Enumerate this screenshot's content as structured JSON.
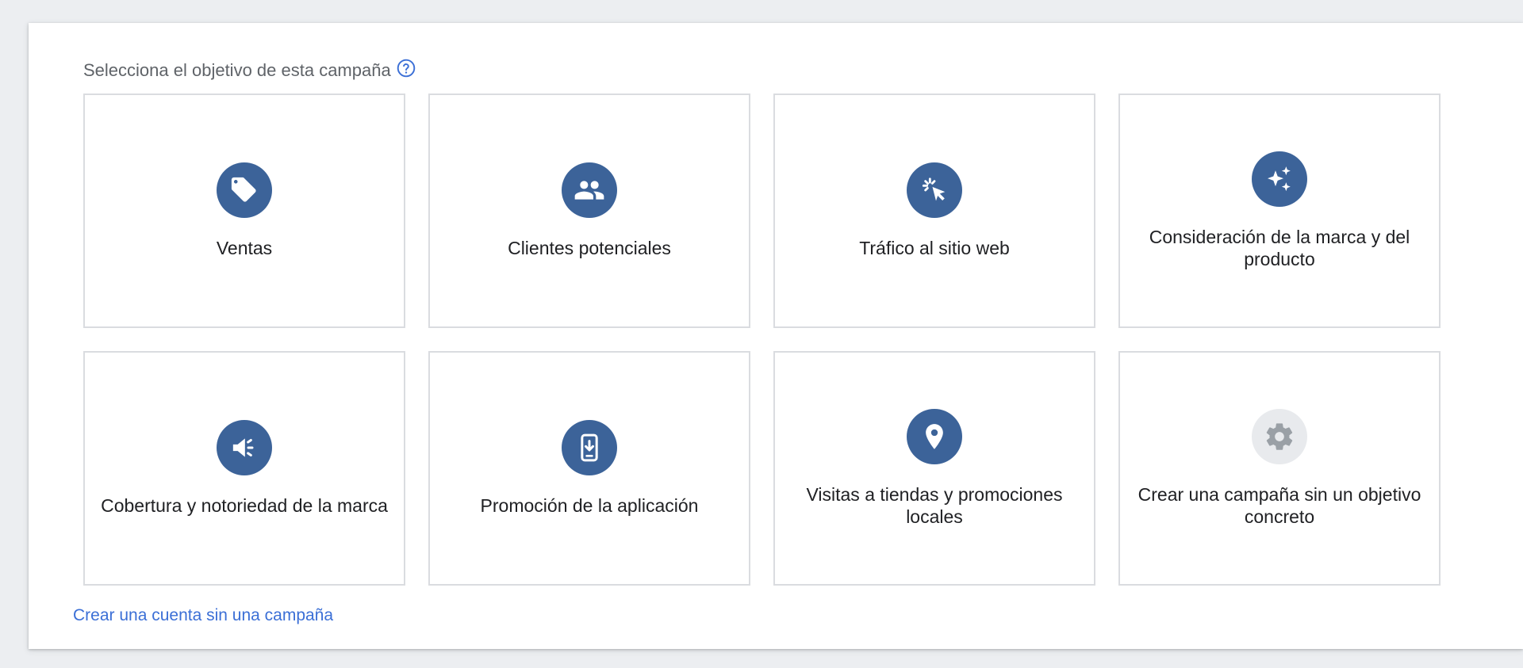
{
  "heading": {
    "text": "Selecciona el objetivo de esta campaña",
    "help_icon": "help-circle-outline-icon"
  },
  "colors": {
    "accent": "#3c6399",
    "link": "#3b6fd6",
    "disabled_circle": "#e8eaed",
    "disabled_glyph": "#9aa0a6"
  },
  "goals": [
    {
      "label": "Ventas",
      "icon": "tag-icon"
    },
    {
      "label": "Clientes potenciales",
      "icon": "people-icon"
    },
    {
      "label": "Tráfico al sitio web",
      "icon": "cursor-click-icon"
    },
    {
      "label": "Consideración de la marca y del producto",
      "icon": "sparkle-icon"
    },
    {
      "label": "Cobertura y notoriedad de la marca",
      "icon": "megaphone-icon"
    },
    {
      "label": "Promoción de la aplicación",
      "icon": "phone-download-icon"
    },
    {
      "label": "Visitas a tiendas y promociones locales",
      "icon": "location-pin-icon"
    },
    {
      "label": "Crear una campaña sin un objetivo concreto",
      "icon": "gear-icon"
    }
  ],
  "footer": {
    "link_text": "Crear una cuenta sin una campaña"
  }
}
